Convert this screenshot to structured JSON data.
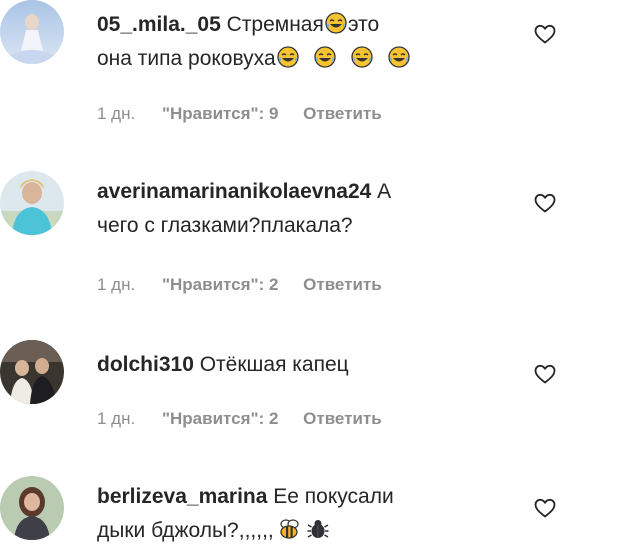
{
  "comments": [
    {
      "username": "05_.mila._05",
      "text_a": "Стремная",
      "text_b": "это",
      "text_c": "она типа роковуха",
      "emoji": "tears-of-joy-emoji",
      "time": "1 дн.",
      "likes": "\"Нравится\": 9",
      "reply": "Ответить"
    },
    {
      "username": "averinamarinanikolaevna24",
      "text_a": "А",
      "text_c": "чего с глазками?плакала?",
      "time": "1 дн.",
      "likes": "\"Нравится\": 2",
      "reply": "Ответить"
    },
    {
      "username": "dolchi310",
      "text_a": "Отёкшая капец",
      "time": "1 дн.",
      "likes": "\"Нравится\": 2",
      "reply": "Ответить"
    },
    {
      "username": "berlizeva_marina",
      "text_a": "Ее покусали",
      "text_c": "дыки бджолы?,,,,,,",
      "emoji_bee": "bee-emoji",
      "emoji_bug": "bug-emoji",
      "time": "",
      "likes": "",
      "reply": ""
    }
  ],
  "icons": {
    "like": "heart-outline-icon"
  },
  "colors": {
    "text": "#262626",
    "meta": "#8e8e8e"
  }
}
